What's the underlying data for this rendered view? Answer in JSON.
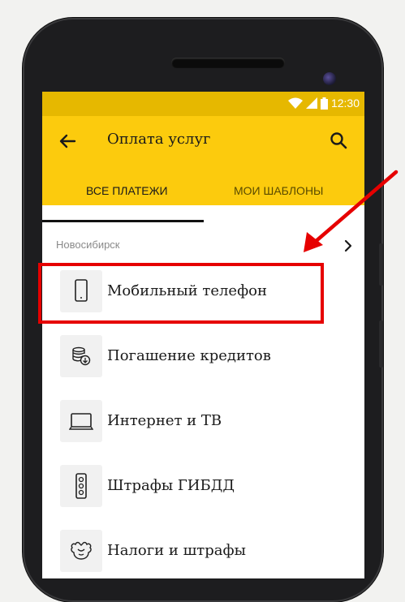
{
  "status_bar": {
    "time": "12:30"
  },
  "app_bar": {
    "title": "Оплата услуг"
  },
  "tabs": [
    {
      "label": "ВСЕ ПЛАТЕЖИ",
      "active": true
    },
    {
      "label": "МОИ ШАБЛОНЫ",
      "active": false
    }
  ],
  "region": {
    "label": "Новосибирск"
  },
  "items": [
    {
      "label": "Мобильный телефон",
      "icon": "mobile-phone-icon"
    },
    {
      "label": "Погашение кредитов",
      "icon": "coins-icon"
    },
    {
      "label": "Интернет и ТВ",
      "icon": "tv-icon"
    },
    {
      "label": "Штрафы ГИБДД",
      "icon": "traffic-light-icon"
    },
    {
      "label": "Налоги и штрафы",
      "icon": "emblem-icon"
    }
  ],
  "colors": {
    "accent": "#fccb0d",
    "status": "#e6b800",
    "highlight": "#e60000"
  }
}
